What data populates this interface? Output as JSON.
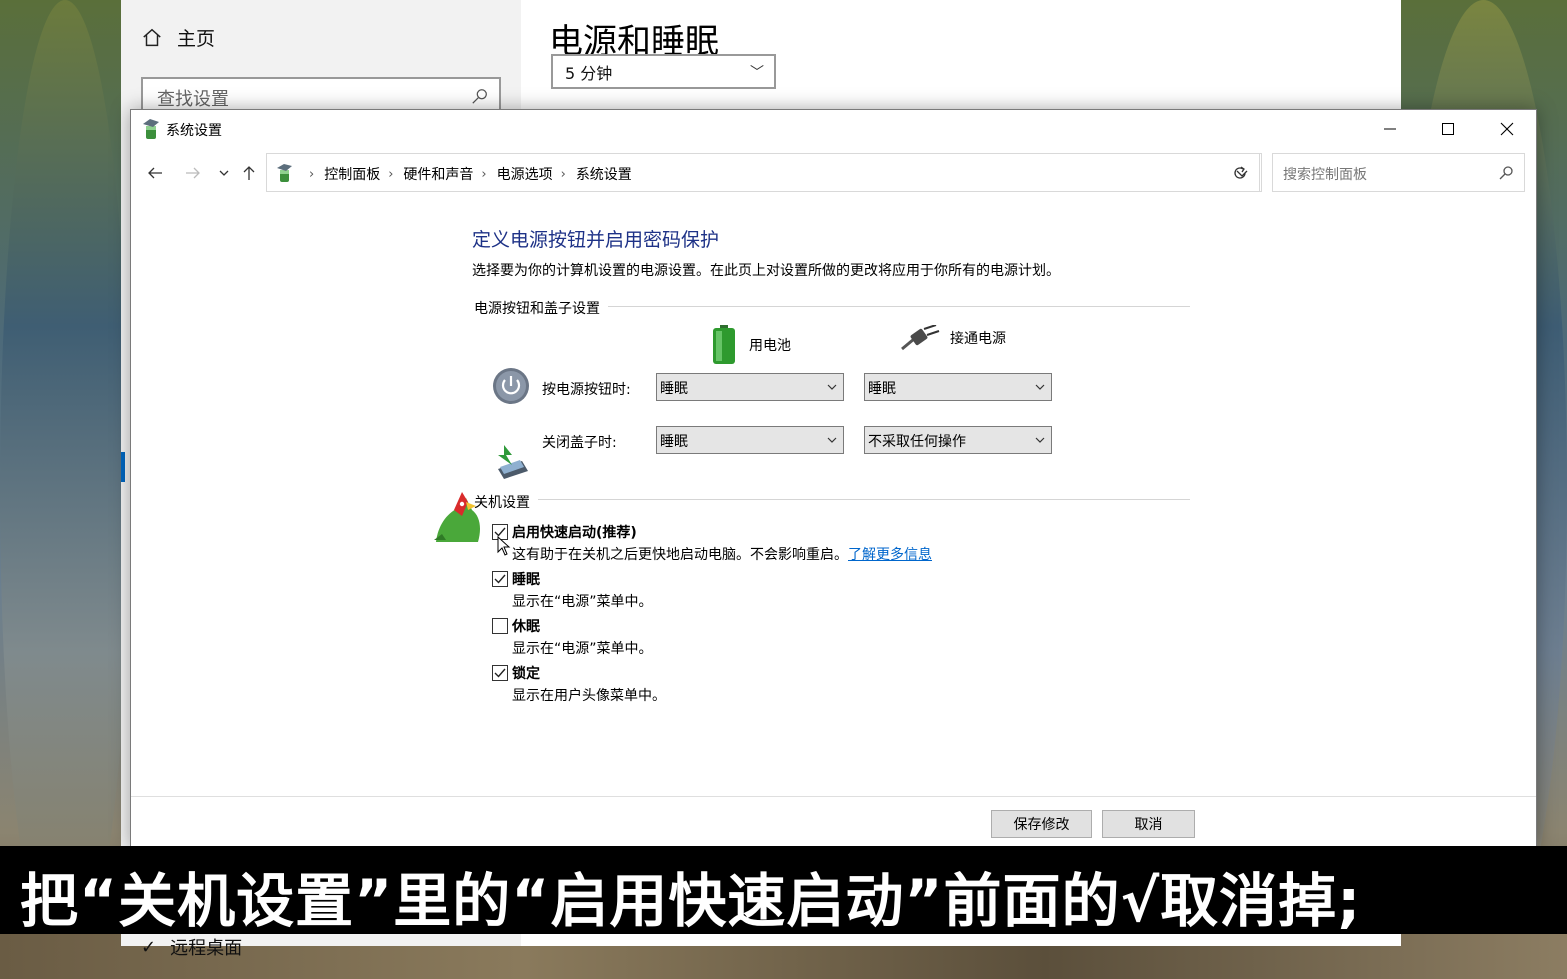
{
  "background_settings": {
    "home_label": "主页",
    "search_placeholder": "查找设置",
    "page_title": "电源和睡眠",
    "dropdown_value": "5 分钟",
    "remote_desktop_label": "远程桌面"
  },
  "window": {
    "title": "系统设置",
    "app_icon": "power-options-icon"
  },
  "navigation": {
    "breadcrumbs": [
      "控制面板",
      "硬件和声音",
      "电源选项",
      "系统设置"
    ],
    "search_placeholder": "搜索控制面板"
  },
  "content": {
    "heading": "定义电源按钮并启用密码保护",
    "description": "选择要为你的计算机设置的电源设置。在此页上对设置所做的更改将应用于你所有的电源计划。",
    "power_group_label": "电源按钮和盖子设置",
    "col_battery": "用电池",
    "col_ac": "接通电源",
    "rows": [
      {
        "label": "按电源按钮时:",
        "battery": "睡眠",
        "ac": "睡眠"
      },
      {
        "label": "关闭盖子时:",
        "battery": "睡眠",
        "ac": "不采取任何操作"
      }
    ],
    "shutdown_group_label": "关机设置",
    "options": [
      {
        "title": "启用快速启动(推荐)",
        "desc": "这有助于在关机之后更快地启动电脑。不会影响重启。",
        "link": "了解更多信息",
        "checked": true
      },
      {
        "title": "睡眠",
        "desc": "显示在“电源”菜单中。",
        "checked": true
      },
      {
        "title": "休眠",
        "desc": "显示在“电源”菜单中。",
        "checked": false
      },
      {
        "title": "锁定",
        "desc": "显示在用户头像菜单中。",
        "checked": true
      }
    ]
  },
  "buttons": {
    "save": "保存修改",
    "cancel": "取消"
  },
  "caption": "把“关机设置”里的“启用快速启动”前面的√取消掉;"
}
